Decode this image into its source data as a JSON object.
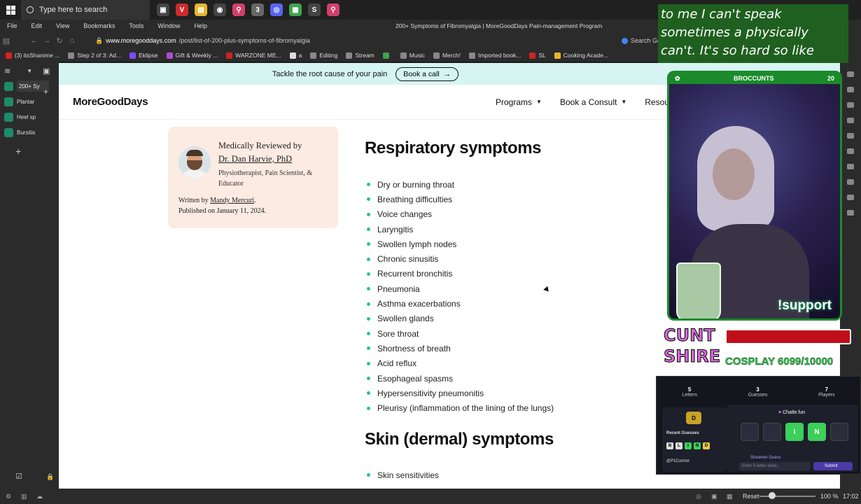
{
  "taskbar": {
    "search_placeholder": "Type here to search",
    "apps": [
      {
        "name": "task-view",
        "color": "#444444",
        "glyph": "▣"
      },
      {
        "name": "vivaldi",
        "color": "#cc2b2b",
        "glyph": "V"
      },
      {
        "name": "explorer",
        "color": "#e8b62c",
        "glyph": "▤"
      },
      {
        "name": "obs",
        "color": "#444444",
        "glyph": "◉"
      },
      {
        "name": "maps",
        "color": "#d23f6a",
        "glyph": "⚲"
      },
      {
        "name": "app-3",
        "color": "#666666",
        "glyph": "3"
      },
      {
        "name": "discord",
        "color": "#5865f2",
        "glyph": "◎"
      },
      {
        "name": "notes",
        "color": "#3fa34d",
        "glyph": "▦"
      },
      {
        "name": "app-s",
        "color": "#444444",
        "glyph": "S"
      },
      {
        "name": "pin",
        "color": "#d23f6a",
        "glyph": "⚲"
      }
    ]
  },
  "browser": {
    "menu": [
      "File",
      "Edit",
      "View",
      "Bookmarks",
      "Tools",
      "Window",
      "Help"
    ],
    "window_title": "200+ Symptoms of Fibromyalgia | MoreGoodDays Pain-management Program",
    "url_host": "www.moregooddays.com",
    "url_path": "/post/list-of-200-plus-symptoms-of-fibromyalgia",
    "search_label": "Search Go",
    "bookmarks": [
      {
        "label": "(3) itsShanime ...",
        "color": "#e02020"
      },
      {
        "label": "Step 2 of 3: Ad...",
        "color": "#888888"
      },
      {
        "label": "Eklipse",
        "color": "#7b4dff"
      },
      {
        "label": "Gift & Weekly ...",
        "color": "#b04ad6"
      },
      {
        "label": "WARZONE ME...",
        "color": "#cc2222"
      },
      {
        "label": "a",
        "color": "#dddddd"
      },
      {
        "label": "Editing",
        "color": "#888888"
      },
      {
        "label": "Stream",
        "color": "#888888"
      },
      {
        "label": "",
        "color": "#3fa34d"
      },
      {
        "label": "Music",
        "color": "#888888"
      },
      {
        "label": "Merch!",
        "color": "#888888"
      },
      {
        "label": "Imported book...",
        "color": "#888888"
      },
      {
        "label": "SL",
        "color": "#cc2222"
      },
      {
        "label": "Cooking Acade...",
        "color": "#e8b62c"
      }
    ],
    "side_tabs": [
      "200+ Sy",
      "Plantar",
      "Heel sp",
      "Bursitis"
    ],
    "status": {
      "reset": "Reset",
      "zoom": "100 %",
      "time": "17:02"
    }
  },
  "page": {
    "announcement": "Tackle the root cause of your pain",
    "announcement_button": "Book a call",
    "logo": "MoreGoodDays",
    "nav": [
      "Programs",
      "Book a Consult",
      "Resource"
    ],
    "reviewer": {
      "label": "Medically Reviewed by",
      "name": "Dr. Dan Harvie, PhD",
      "role": "Physiotherapist, Pain Scientist, & Educator",
      "written_prefix": "Written by",
      "author": "Mandy Mercuri",
      "published": "Published on January 11, 2024."
    },
    "respiratory_heading": "Respiratory symptoms",
    "respiratory": [
      "Dry or burning throat",
      "Breathing difficulties",
      "Voice changes",
      "Laryngitis",
      "Swollen lymph nodes",
      "Chronic sinusitis",
      "Recurrent bronchitis",
      "Pneumonia",
      "Asthma exacerbations",
      "Swollen glands",
      "Sore throat",
      "Shortness of breath",
      "Acid reflux",
      "Esophageal spasms",
      "Hypersensitivity pneumonitis",
      "Pleurisy (inflammation of the lining of the lungs)"
    ],
    "skin_heading": "Skin (dermal) symptoms",
    "skin": [
      "Skin sensitivities"
    ]
  },
  "overlay": {
    "caption": "to me I can't speak sometimes a physically can't. It's so hard so like",
    "cam_name": "BROCCUNTS",
    "cam_count": "20",
    "support": "!support",
    "goal_logo": "CUNT SHIRE",
    "goal_text": "COSPLAY 6099/10000",
    "game": {
      "stats": [
        {
          "value": "5",
          "label": "Letters"
        },
        {
          "value": "3",
          "label": "Guesses"
        },
        {
          "value": "7",
          "label": "Players"
        }
      ],
      "title": "Chatle.fun",
      "recent_label": "Recent Guesses",
      "recent_user": "@P1Connor",
      "recent_letters": [
        "B",
        "L",
        "I",
        "N",
        "D"
      ],
      "board": [
        "",
        "",
        "I",
        "N",
        ""
      ],
      "streamer_label": "Streamer Guess",
      "input_placeholder": "Enter 5-letter word...",
      "submit": "Submit",
      "top_tile": "D"
    }
  }
}
